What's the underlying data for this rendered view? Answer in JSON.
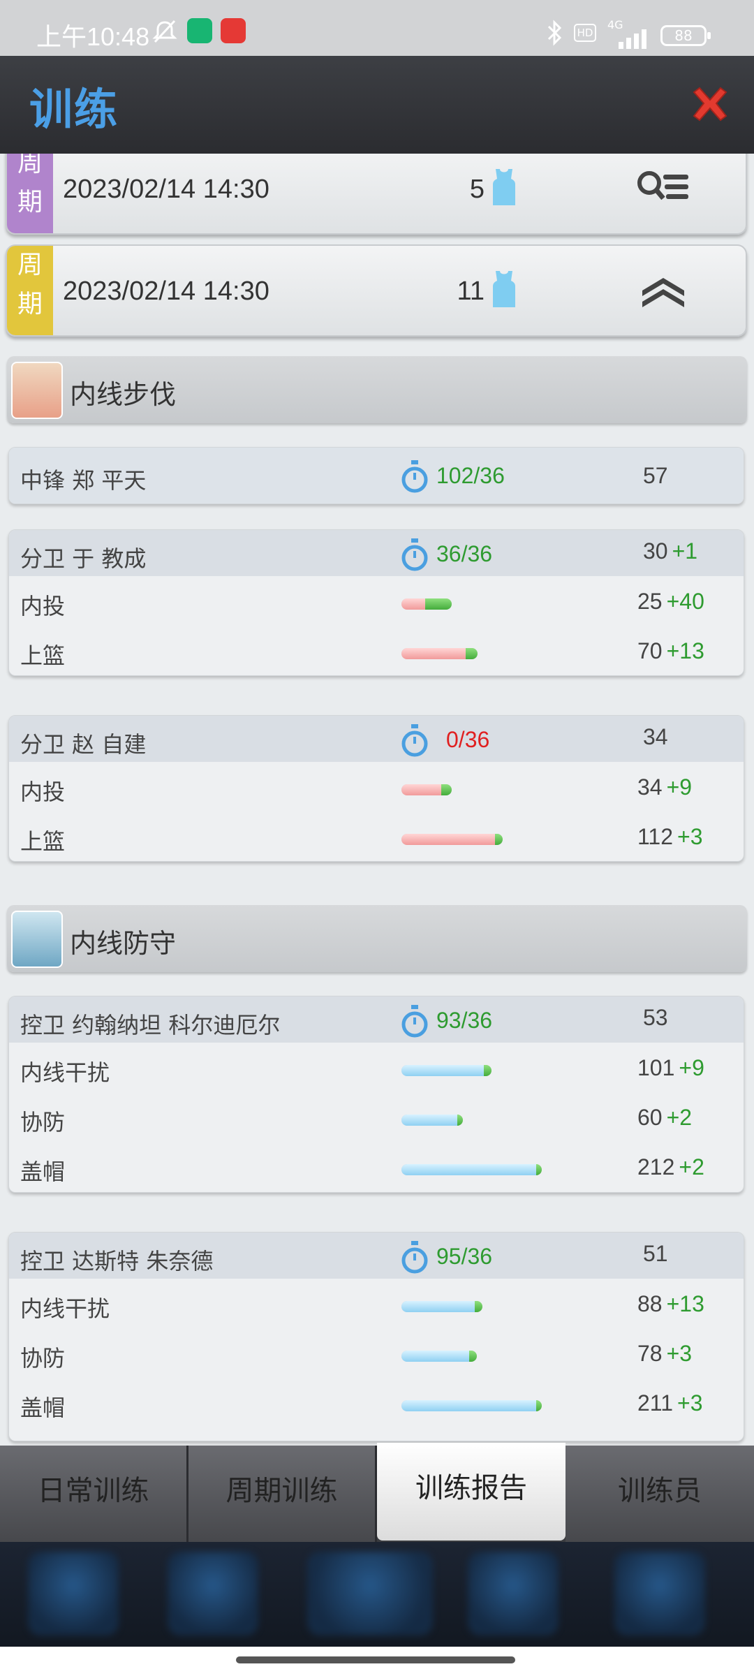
{
  "status_bar": {
    "time": "上午10:48",
    "battery": "88",
    "network": "4G",
    "hd": "HD"
  },
  "header": {
    "title": "训练"
  },
  "cycles": [
    {
      "tag": "周期",
      "tag_color": "#b084cc",
      "date": "2023/02/14 14:30",
      "count": "5",
      "action": "search-list-icon"
    },
    {
      "tag": "周期",
      "tag_color": "#e2c63c",
      "date": "2023/02/14 14:30",
      "count": "11",
      "action": "collapse-icon"
    }
  ],
  "sections": [
    {
      "title": "内线步伐",
      "cards": [
        {
          "player": "中锋 郑 平天",
          "progress": "102/36",
          "progress_color": "#2e9b30",
          "overall": "57",
          "overall_gain": "",
          "skills": []
        },
        {
          "player": "分卫 于 教成",
          "progress": "36/36",
          "progress_color": "#2e9b30",
          "overall": "30",
          "overall_gain": "+1",
          "skills": [
            {
              "label": "内投",
              "value": "25",
              "gain": "+40",
              "base_fraction": 0.16,
              "gain_fraction": 0.18
            },
            {
              "label": "上篮",
              "value": "70",
              "gain": "+13",
              "base_fraction": 0.44,
              "gain_fraction": 0.08
            }
          ]
        },
        {
          "player": "分卫 赵 自建",
          "progress": "0/36",
          "progress_color": "#e02020",
          "overall": "34",
          "overall_gain": "",
          "skills": [
            {
              "label": "内投",
              "value": "34",
              "gain": "+9",
              "base_fraction": 0.27,
              "gain_fraction": 0.07
            },
            {
              "label": "上篮",
              "value": "112",
              "gain": "+3",
              "base_fraction": 0.64,
              "gain_fraction": 0.05
            }
          ]
        }
      ]
    },
    {
      "title": "内线防守",
      "cards": [
        {
          "player": "控卫 约翰纳坦 科尔迪厄尔",
          "progress": "93/36",
          "progress_color": "#2e9b30",
          "overall": "53",
          "overall_gain": "",
          "skills": [
            {
              "label": "内线干扰",
              "value": "101",
              "gain": "+9",
              "base_fraction": 0.56,
              "gain_fraction": 0.05
            },
            {
              "label": "协防",
              "value": "60",
              "gain": "+2",
              "base_fraction": 0.38,
              "gain_fraction": 0.04
            },
            {
              "label": "盖帽",
              "value": "212",
              "gain": "+2",
              "base_fraction": 0.92,
              "gain_fraction": 0.04
            }
          ]
        },
        {
          "player": "控卫 达斯特 朱奈德",
          "progress": "95/36",
          "progress_color": "#2e9b30",
          "overall": "51",
          "overall_gain": "",
          "skills": [
            {
              "label": "内线干扰",
              "value": "88",
              "gain": "+13",
              "base_fraction": 0.5,
              "gain_fraction": 0.05
            },
            {
              "label": "协防",
              "value": "78",
              "gain": "+3",
              "base_fraction": 0.46,
              "gain_fraction": 0.05
            },
            {
              "label": "盖帽",
              "value": "211",
              "gain": "+3",
              "base_fraction": 0.92,
              "gain_fraction": 0.04
            }
          ]
        }
      ]
    }
  ],
  "tabs": [
    {
      "label": "日常训练",
      "active": false
    },
    {
      "label": "周期训练",
      "active": false
    },
    {
      "label": "训练报告",
      "active": true
    },
    {
      "label": "训练员",
      "active": false
    }
  ]
}
